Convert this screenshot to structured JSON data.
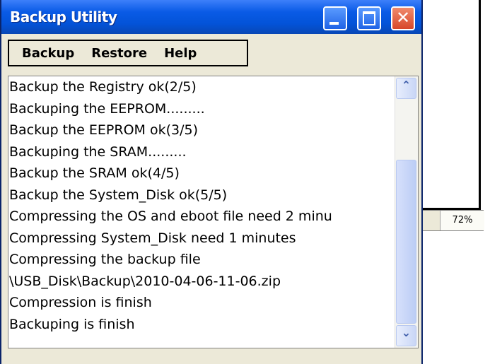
{
  "window": {
    "title": "Backup Utility"
  },
  "titlebar_buttons": {
    "close_glyph": "✕"
  },
  "menu": {
    "items": [
      "Backup",
      "Restore",
      "Help"
    ]
  },
  "log": {
    "lines": [
      "Backup the Registry ok(2/5)",
      "Backuping the EEPROM.........",
      "Backup the EEPROM ok(3/5)",
      "Backuping the SRAM.........",
      "Backup the SRAM ok(4/5)",
      "Backup the System_Disk ok(5/5)",
      "Compressing the OS and eboot file need 2 minu",
      "Compressing System_Disk need 1 minutes",
      "Compressing the backup file",
      "\\USB_Disk\\Backup\\2010-04-06-11-06.zip",
      "Compression is finish",
      "Backuping is finish"
    ]
  },
  "scrollbar": {
    "up_glyph": "⌃",
    "down_glyph": "⌄"
  },
  "background_window": {
    "progress_text": "72%"
  },
  "colors": {
    "titlebar": "#0a5be6",
    "close_button": "#d7472a",
    "dialog_face": "#ece9d8"
  }
}
